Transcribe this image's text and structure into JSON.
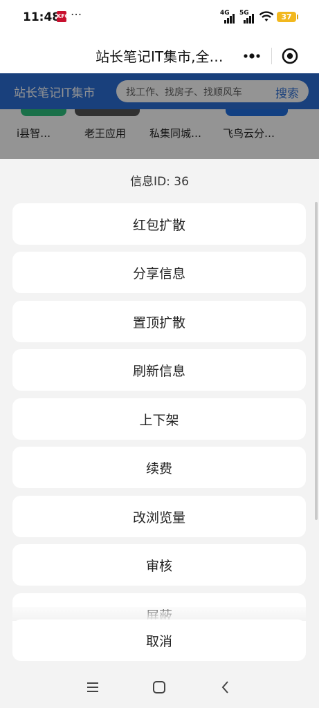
{
  "status_bar": {
    "time": "11:48",
    "more": "···",
    "signal_1": "4G",
    "signal_2": "5G",
    "battery": "37",
    "battery_color": "#f2b81e"
  },
  "title_bar": {
    "title": "站长笔记IT集市,全…",
    "more_icon": "more-dots-icon",
    "close_icon": "target-close-icon"
  },
  "page": {
    "header_title": "站长笔记IT集市",
    "search_placeholder": "找工作、找房子、找顺风车",
    "search_button": "搜索",
    "header_color": "#2c6fd6",
    "apps": [
      {
        "label": "i县智…",
        "color": "#2ec27e"
      },
      {
        "label": "老王应用",
        "color": "#555555"
      },
      {
        "label": "私集同城…",
        "color": "#ffffff"
      },
      {
        "label": "飞鸟云分…",
        "color": "#1f6fe0"
      }
    ]
  },
  "action_sheet": {
    "header": "信息ID: 36",
    "items": [
      "红包扩散",
      "分享信息",
      "置顶扩散",
      "刷新信息",
      "上下架",
      "续费",
      "改浏览量",
      "审核",
      "屏蔽"
    ],
    "cancel": "取消"
  },
  "nav_bar": {
    "menu_icon": "menu-icon",
    "home_icon": "home-icon",
    "back_icon": "back-icon"
  }
}
